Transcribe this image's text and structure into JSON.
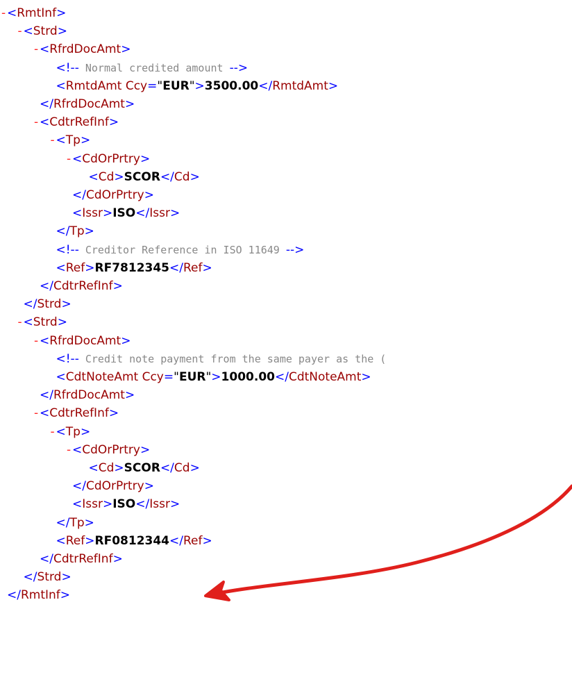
{
  "xml": {
    "lines": [
      {
        "indent": 0,
        "toggle": "-",
        "kind": "open",
        "tag": "RmtInf"
      },
      {
        "indent": 1,
        "toggle": "-",
        "kind": "open",
        "tag": "Strd"
      },
      {
        "indent": 2,
        "toggle": "-",
        "kind": "open",
        "tag": "RfrdDocAmt"
      },
      {
        "indent": 3,
        "kind": "comment",
        "text": "Normal credited amount  "
      },
      {
        "indent": 3,
        "kind": "element",
        "tag": "RmtdAmt",
        "attr": {
          "name": "Ccy",
          "value": "EUR"
        },
        "value": "3500.00"
      },
      {
        "indent": 2,
        "kind": "close",
        "tag": "RfrdDocAmt"
      },
      {
        "indent": 2,
        "toggle": "-",
        "kind": "open",
        "tag": "CdtrRefInf"
      },
      {
        "indent": 3,
        "toggle": "-",
        "kind": "open",
        "tag": "Tp"
      },
      {
        "indent": 4,
        "toggle": "-",
        "kind": "open",
        "tag": "CdOrPrtry"
      },
      {
        "indent": 5,
        "kind": "element",
        "tag": "Cd",
        "value": "SCOR"
      },
      {
        "indent": 4,
        "kind": "close",
        "tag": "CdOrPrtry"
      },
      {
        "indent": 4,
        "kind": "element",
        "tag": "Issr",
        "value": "ISO"
      },
      {
        "indent": 3,
        "kind": "close",
        "tag": "Tp"
      },
      {
        "indent": 3,
        "kind": "comment",
        "text": "Creditor Reference in ISO 11649"
      },
      {
        "indent": 3,
        "kind": "element",
        "tag": "Ref",
        "value": "RF7812345"
      },
      {
        "indent": 2,
        "kind": "close",
        "tag": "CdtrRefInf"
      },
      {
        "indent": 1,
        "kind": "close",
        "tag": "Strd"
      },
      {
        "indent": 1,
        "toggle": "-",
        "kind": "open",
        "tag": "Strd"
      },
      {
        "indent": 2,
        "toggle": "-",
        "kind": "open",
        "tag": "RfrdDocAmt"
      },
      {
        "indent": 3,
        "kind": "comment-open",
        "text": "Credit note payment from the same payer as the ("
      },
      {
        "indent": 3,
        "kind": "element",
        "tag": "CdtNoteAmt",
        "attr": {
          "name": "Ccy",
          "value": "EUR"
        },
        "value": "1000.00"
      },
      {
        "indent": 2,
        "kind": "close",
        "tag": "RfrdDocAmt"
      },
      {
        "indent": 2,
        "toggle": "-",
        "kind": "open",
        "tag": "CdtrRefInf"
      },
      {
        "indent": 3,
        "toggle": "-",
        "kind": "open",
        "tag": "Tp"
      },
      {
        "indent": 4,
        "toggle": "-",
        "kind": "open",
        "tag": "CdOrPrtry"
      },
      {
        "indent": 5,
        "kind": "element",
        "tag": "Cd",
        "value": "SCOR"
      },
      {
        "indent": 4,
        "kind": "close",
        "tag": "CdOrPrtry"
      },
      {
        "indent": 4,
        "kind": "element",
        "tag": "Issr",
        "value": "ISO"
      },
      {
        "indent": 3,
        "kind": "close",
        "tag": "Tp"
      },
      {
        "indent": 3,
        "kind": "element",
        "tag": "Ref",
        "value": "RF0812344"
      },
      {
        "indent": 2,
        "kind": "close",
        "tag": "CdtrRefInf"
      },
      {
        "indent": 1,
        "kind": "close",
        "tag": "Strd"
      },
      {
        "indent": 0,
        "kind": "close",
        "tag": "RmtInf"
      }
    ]
  },
  "annotation": {
    "icon": "red-arrow-icon",
    "color": "#e0201c"
  },
  "colors": {
    "bracket": "#0000ff",
    "tag_name": "#990000",
    "toggle": "#ff2222",
    "comment": "#888888",
    "value": "#000000"
  }
}
